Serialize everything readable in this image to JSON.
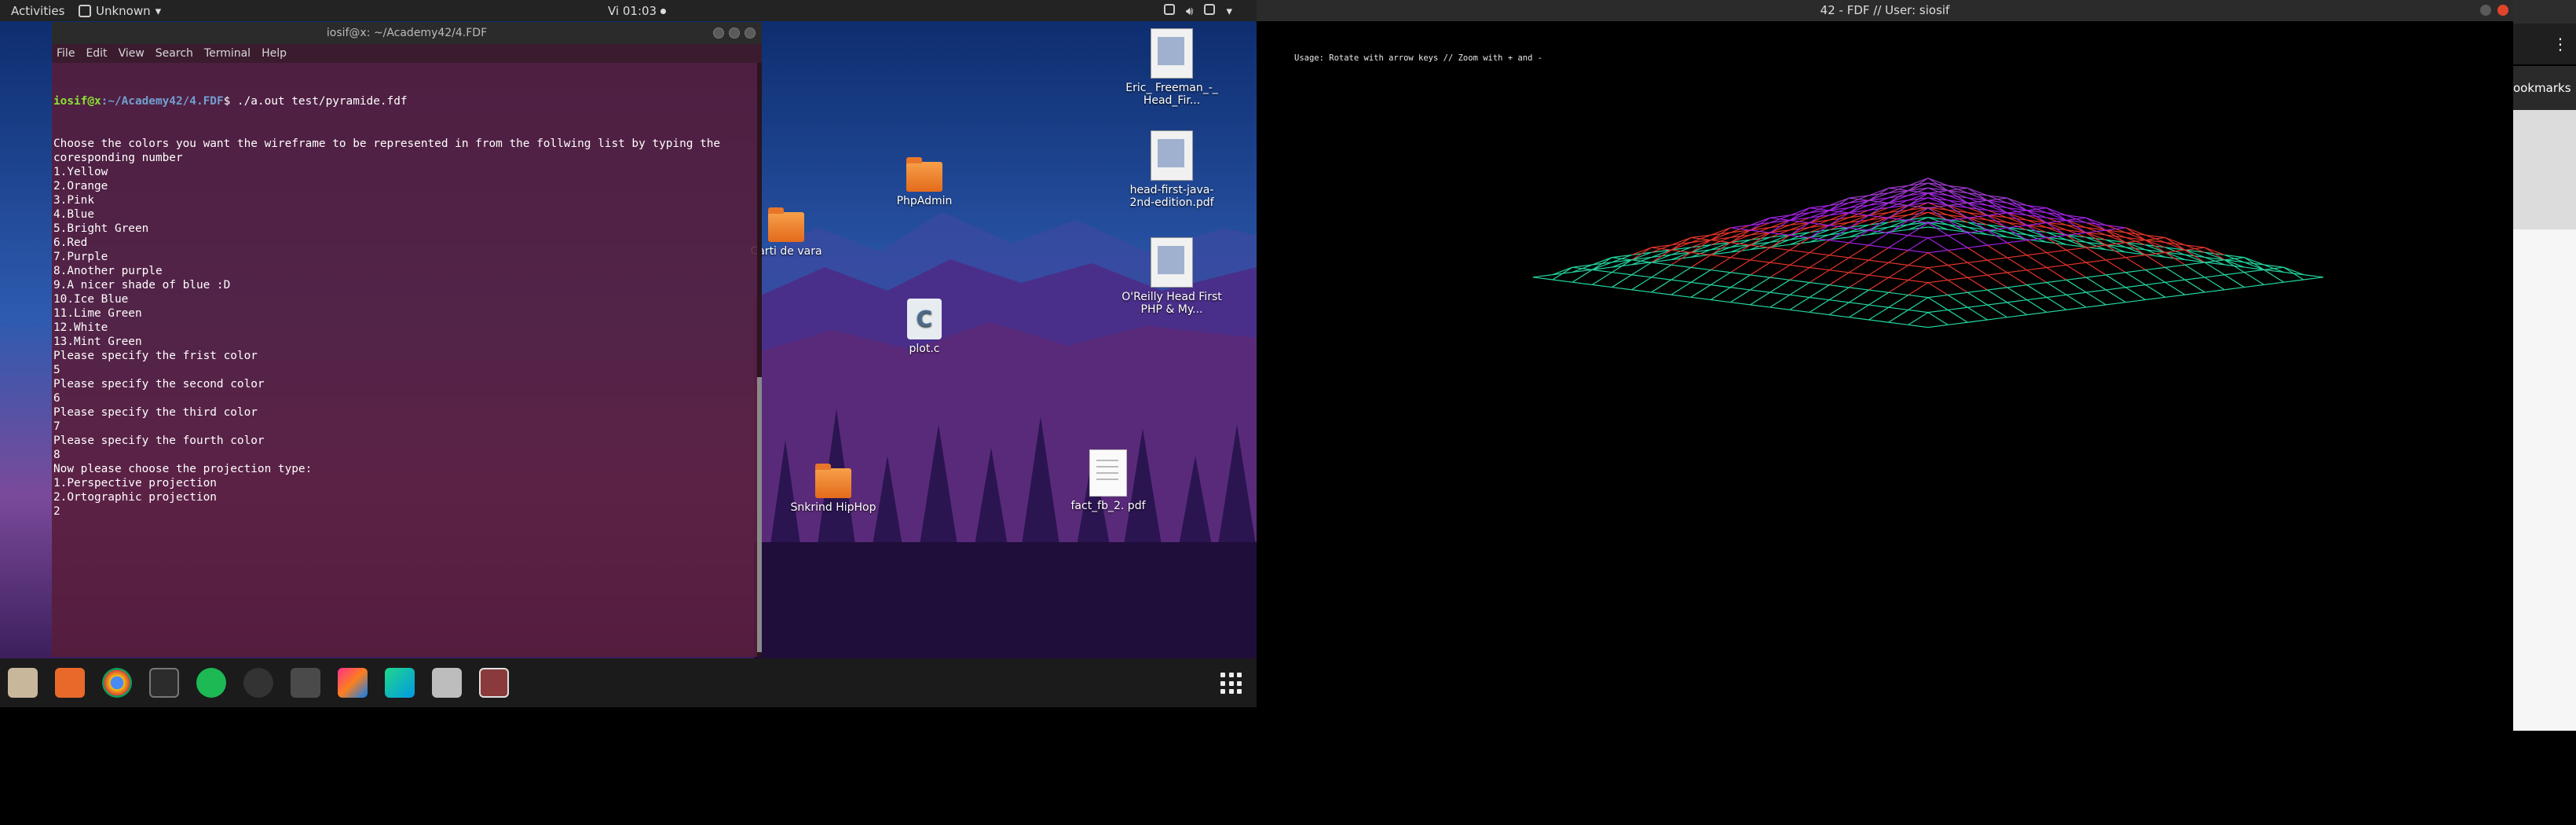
{
  "topbar": {
    "activities": "Activities",
    "app_menu": "Unknown",
    "clock": "Vi 01:03"
  },
  "terminal": {
    "title": "iosif@x: ~/Academy42/4.FDF",
    "menu": [
      "File",
      "Edit",
      "View",
      "Search",
      "Terminal",
      "Help"
    ],
    "prompt_user": "iosif@x",
    "prompt_path": ":~/Academy42/4.FDF",
    "prompt_cmd": "$ ./a.out test/pyramide.fdf",
    "lines": [
      "Choose the colors you want the wireframe to be represented in from the follwing list by typing the",
      "coresponding number",
      "1.Yellow",
      "2.Orange",
      "3.Pink",
      "4.Blue",
      "5.Bright Green",
      "6.Red",
      "7.Purple",
      "8.Another purple",
      "9.A nicer shade of blue :D",
      "10.Ice Blue",
      "11.Lime Green",
      "12.White",
      "13.Mint Green",
      "Please specify the frist color",
      "5",
      "Please specify the second color",
      "6",
      "Please specify the third color",
      "7",
      "Please specify the fourth color",
      "8",
      "Now please choose the projection type:",
      "1.Perspective projection",
      "2.Ortographic projection",
      "2"
    ]
  },
  "desktop": {
    "icons": [
      {
        "label": "Eric_ Freeman_-_ Head_Fir...",
        "kind": "book"
      },
      {
        "label": "head-first-java-2nd-edition.pdf",
        "kind": "book"
      },
      {
        "label": "O'Reilly Head First PHP & My...",
        "kind": "book"
      },
      {
        "label": "PhpAdmin",
        "kind": "folder"
      },
      {
        "label": "Carti de vara",
        "kind": "folder"
      },
      {
        "label": "plot.c",
        "kind": "c-file"
      },
      {
        "label": "Snkrind HipHop",
        "kind": "folder"
      },
      {
        "label": "fact_fb_2. pdf",
        "kind": "doc"
      }
    ]
  },
  "fdf": {
    "title": "42 - FDF // User: siosif",
    "usage": "Usage: Rotate with arrow keys // Zoom with + and -",
    "colors": {
      "tier1": "#24d4a0",
      "tier2": "#e0342a",
      "tier3": "#a020e0",
      "tier4": "#9a3ac8"
    }
  },
  "browser_peek": {
    "bookmarks": "ookmarks"
  }
}
